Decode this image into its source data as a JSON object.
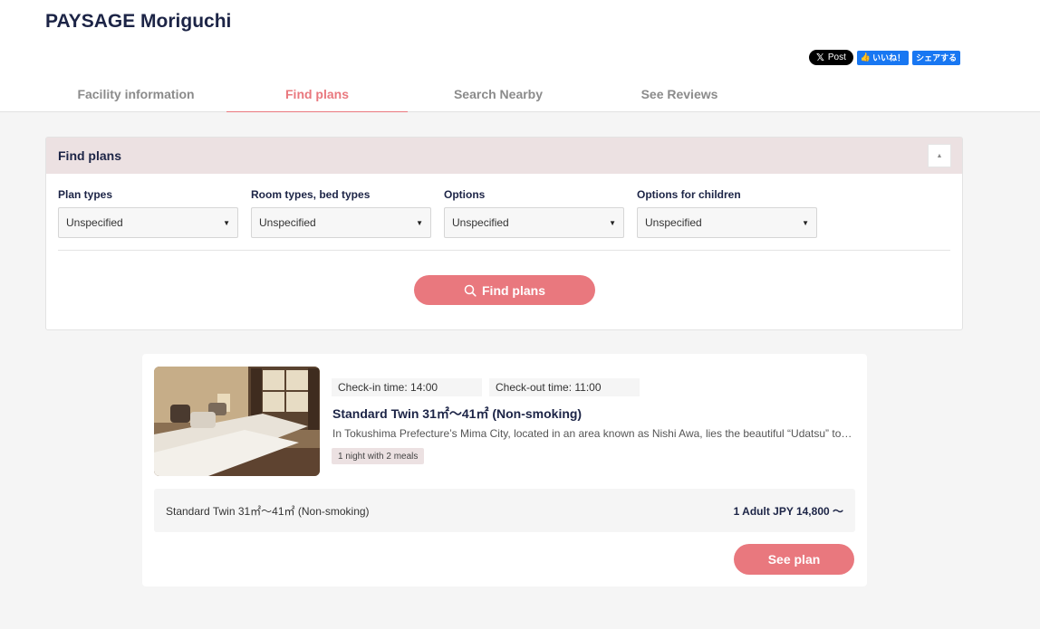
{
  "header": {
    "title": "PAYSAGE Moriguchi",
    "social": {
      "x_post_label": "Post",
      "fb_like_label": "いいね！",
      "fb_share_label": "シェアする"
    },
    "tabs": [
      {
        "label": "Facility information",
        "active": false
      },
      {
        "label": "Find plans",
        "active": true
      },
      {
        "label": "Search Nearby",
        "active": false
      },
      {
        "label": "See Reviews",
        "active": false
      }
    ]
  },
  "search_panel": {
    "title": "Find plans",
    "filters": [
      {
        "label": "Plan types",
        "value": "Unspecified"
      },
      {
        "label": "Room types, bed types",
        "value": "Unspecified"
      },
      {
        "label": "Options",
        "value": "Unspecified"
      },
      {
        "label": "Options for children",
        "value": "Unspecified"
      }
    ],
    "submit_label": "Find plans"
  },
  "plan_card": {
    "check_in": "Check-in time: 14:00",
    "check_out": "Check-out time: 11:00",
    "title": "Standard Twin 31㎡〜41㎡ (Non-smoking)",
    "description": "In Tokushima Prefecture’s Mima City, located in an area known as Nishi Awa, lies the beautiful “Udatsu” town, where the old streets remain...",
    "meal_tag": "1 night with 2 meals",
    "room_name": "Standard Twin 31㎡〜41㎡ (Non-smoking)",
    "price": "1 Adult JPY 14,800 〜",
    "see_plan_label": "See plan"
  },
  "colors": {
    "accent": "#e9787e",
    "navy": "#1c2446",
    "panel_header": "#ece1e2"
  }
}
